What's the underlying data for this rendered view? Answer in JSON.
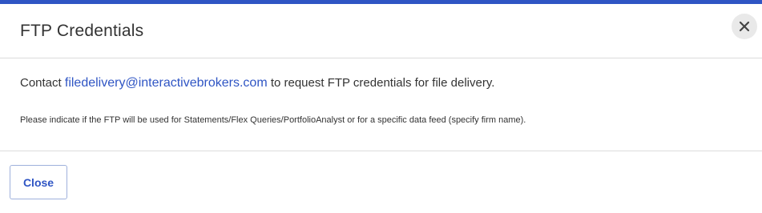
{
  "modal": {
    "title": "FTP Credentials",
    "close_icon": "close-icon",
    "message": {
      "prefix": "Contact ",
      "email": "filedelivery@interactivebrokers.com",
      "suffix": " to request FTP credentials for file delivery."
    },
    "note": "Please indicate if the FTP will be used for Statements/Flex Queries/PortfolioAnalyst or for a specific data feed (specify firm name).",
    "close_button_label": "Close",
    "colors": {
      "accent": "#2f55c4",
      "text": "#333333",
      "divider": "#dcdcdc"
    }
  }
}
